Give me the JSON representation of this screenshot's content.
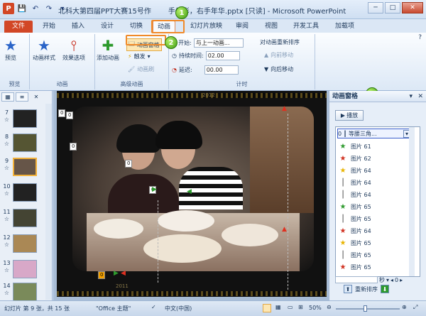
{
  "window": {
    "title": "北科大第四届PPT大赛15号作品：手倒影，右手年华.pptx [只读] - Microsoft PowerPoint",
    "title_display": "北科大第四届PPT大赛15号作",
    "title_tail": "手倒影，右手年华.pptx [只读] - Microsoft PowerPoint",
    "controls": [
      "─",
      "□",
      "✕"
    ]
  },
  "tabs": [
    "文件",
    "开始",
    "插入",
    "设计",
    "切换",
    "动画",
    "幻灯片放映",
    "审阅",
    "视图",
    "开发工具",
    "加载项"
  ],
  "ribbon": {
    "preview": {
      "label": "预览",
      "group": "预览"
    },
    "animation": {
      "style": "动画样式",
      "effect": "效果选项",
      "group": "动画"
    },
    "advanced": {
      "add": "添加动画",
      "pane": "动画窗格",
      "trigger": "触发",
      "brush": "动画刷",
      "group": "高级动画"
    },
    "timing": {
      "start_label": "开始:",
      "start_value": "与上一动画...",
      "duration_label": "持续时间:",
      "duration_value": "02.00",
      "delay_label": "延迟:",
      "delay_value": "00.00",
      "reorder_title": "对动画重新排序",
      "forward": "向前移动",
      "back": "向后移动",
      "group": "计时"
    }
  },
  "slides": [
    {
      "num": "7",
      "mark": "☆"
    },
    {
      "num": "8",
      "mark": "☆"
    },
    {
      "num": "9",
      "mark": "☆"
    },
    {
      "num": "10",
      "mark": "☆"
    },
    {
      "num": "11",
      "mark": "☆"
    },
    {
      "num": "12",
      "mark": "☆"
    },
    {
      "num": "13",
      "mark": "☆"
    },
    {
      "num": "14",
      "mark": "☆"
    }
  ],
  "slide": {
    "year_top": "2012",
    "year_bottom": "2011",
    "tags": [
      "0",
      "0",
      "0",
      "0",
      "0",
      "0"
    ]
  },
  "anim_pane": {
    "title": "动画窗格",
    "play": "播放",
    "header_item": "0 ┃ 等腰三角...",
    "items": [
      {
        "icon": "star-green",
        "name": "图片 61"
      },
      {
        "icon": "star-red",
        "name": "图片 62"
      },
      {
        "icon": "star-yellow",
        "name": "图片 64"
      },
      {
        "icon": "bar",
        "name": "图片 64"
      },
      {
        "icon": "bar",
        "name": "图片 64"
      },
      {
        "icon": "star-green",
        "name": "图片 65"
      },
      {
        "icon": "bar",
        "name": "图片 65"
      },
      {
        "icon": "star-red",
        "name": "图片 64"
      },
      {
        "icon": "star-yellow",
        "name": "图片 65"
      },
      {
        "icon": "bar",
        "name": "图片 65"
      },
      {
        "icon": "star-red",
        "name": "图片 65"
      }
    ],
    "seconds_label": "秒",
    "seconds_value": "0",
    "reorder": "重新排序"
  },
  "callouts": [
    "1",
    "2",
    "3"
  ],
  "status": {
    "slide_info": "幻灯片 第 9 张，共 15 张",
    "theme": "\"Office 主题\"",
    "language": "中文(中国)",
    "zoom": "50%"
  },
  "colors": {
    "file_tab": "#d24726",
    "active_border": "#e08850",
    "callout": "#3e9a12"
  }
}
